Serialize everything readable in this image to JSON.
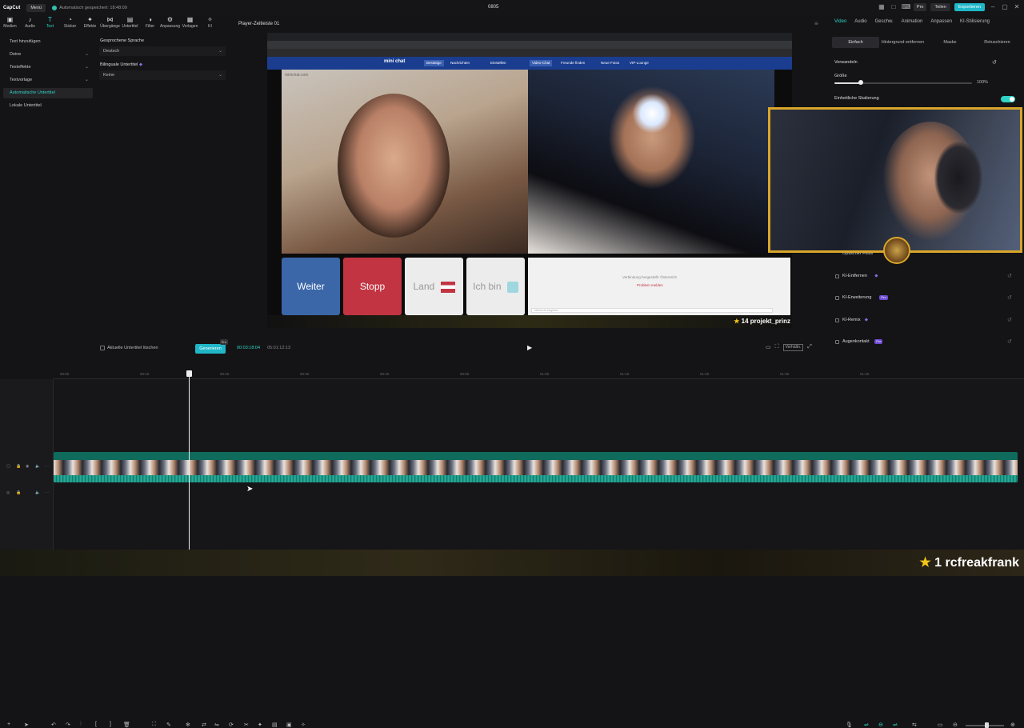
{
  "app": {
    "logo": "CapCut",
    "menu_label": "Menü",
    "save_status": "Automatisch gespeichert: 18:48:09",
    "project_name": "0805",
    "pro_label": "Pro",
    "share_label": "Teilen",
    "export_label": "Exportieren"
  },
  "toolbar": [
    {
      "label": "Medien",
      "icon": "media-icon"
    },
    {
      "label": "Audio",
      "icon": "audio-icon"
    },
    {
      "label": "Text",
      "icon": "text-icon",
      "active": true
    },
    {
      "label": "Sticker",
      "icon": "sticker-icon"
    },
    {
      "label": "Effekte",
      "icon": "effects-icon"
    },
    {
      "label": "Übergänge",
      "icon": "transitions-icon"
    },
    {
      "label": "Untertitel",
      "icon": "subtitles-icon"
    },
    {
      "label": "Filter",
      "icon": "filter-icon"
    },
    {
      "label": "Anpassung",
      "icon": "adjust-icon"
    },
    {
      "label": "Vorlagen",
      "icon": "templates-icon"
    },
    {
      "label": "KI",
      "icon": "ai-icon"
    }
  ],
  "left_nav": [
    {
      "label": "Text hinzufügen"
    },
    {
      "label": "Deine",
      "chevron": true
    },
    {
      "label": "Texteffekte",
      "chevron": true
    },
    {
      "label": "Textvorlage",
      "chevron": true
    },
    {
      "label": "Automatische Untertitel",
      "active": true
    },
    {
      "label": "Lokale Untertitel"
    }
  ],
  "subtitle_panel": {
    "spoken_language_label": "Gesprochene Sprache",
    "spoken_language_value": "Deutsch",
    "bilingual_label": "Bilinguale Untertitel",
    "bilingual_value": "Keine",
    "clear_label": "Aktuelle Untertitel löschen",
    "generate_label": "Generieren",
    "generate_badge": "Pro"
  },
  "player": {
    "title": "Player-Zeitleiste 01",
    "current_time": "00:03:18:04",
    "total_time": "05:01:12:13",
    "ratio_label": "Verhältn."
  },
  "video": {
    "site_name": "mini chat",
    "site_watermark": "minichat.com",
    "nav_items": [
      "Bestätige",
      "Nachrichten",
      "Einstellen",
      "Video-Chat",
      "Freunde finden",
      "Neue Fotos",
      "VIP-Lounge"
    ],
    "buttons": [
      "Weiter",
      "Stopp",
      "Land",
      "Ich bin"
    ],
    "chat_line1": "Verbindung hergestellt: Österreich",
    "chat_line2": "Problem melden",
    "chat_input_placeholder": "Nachricht eingeben",
    "credit_count": "14",
    "credit_name": "projekt_prinz"
  },
  "right_panel": {
    "tabs": [
      {
        "label": "Video",
        "active": true
      },
      {
        "label": "Audio"
      },
      {
        "label": "Geschw."
      },
      {
        "label": "Animation"
      },
      {
        "label": "Anpassen"
      },
      {
        "label": "KI-Stilisierung"
      }
    ],
    "sub_tabs": [
      {
        "label": "Einfach",
        "active": true
      },
      {
        "label": "Hintergrund entfernen"
      },
      {
        "label": "Maske"
      },
      {
        "label": "Retuschieren"
      }
    ],
    "transform_label": "Verwandeln",
    "size_label": "Größe",
    "size_value": "100%",
    "size_fraction": 0.19,
    "uniform_scale_label": "Einheitliche Skalierung",
    "optical_flow_label": "Optischer Fluss",
    "ai_items": [
      {
        "label": "KI-Entfernen",
        "badge": ""
      },
      {
        "label": "KI-Erweiterung",
        "badge": "Pro"
      },
      {
        "label": "KI-Remix",
        "badge": ""
      },
      {
        "label": "Augenkontakt",
        "badge": "Pro"
      }
    ]
  },
  "timeline": {
    "ruler_labels": [
      "00:00",
      "00:10",
      "00:20",
      "00:30",
      "00:40",
      "00:50",
      "01:00",
      "01:10",
      "01:20",
      "01:30",
      "01:40"
    ]
  },
  "stream_overlay": {
    "credit_count": "1",
    "credit_name": "rcfreakfrank"
  },
  "colors": {
    "accent": "#2fd3c6",
    "export": "#1fb6c8",
    "frame_gold": "#d9a62a",
    "button_blue": "#3b67a8",
    "button_red": "#c23442"
  }
}
